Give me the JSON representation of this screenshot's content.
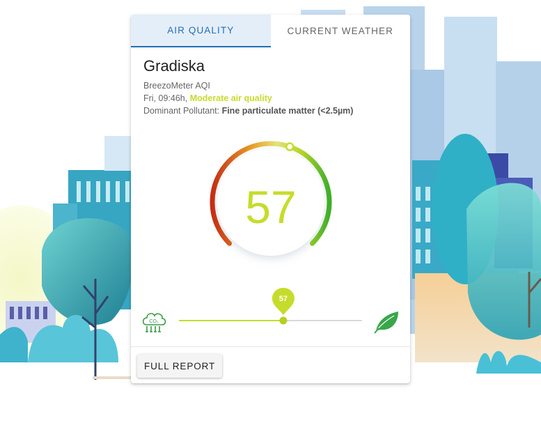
{
  "tabs": [
    {
      "label": "AIR QUALITY",
      "active": true
    },
    {
      "label": "CURRENT WEATHER",
      "active": false
    }
  ],
  "location": {
    "city": "Gradiska",
    "index_name": "BreezoMeter AQI",
    "datetime": "Fri, 09:46h,",
    "aqi_description": "Moderate air quality",
    "pollutant_label": "Dominant Pollutant:",
    "pollutant_value": "Fine particulate matter (<2.5µm)"
  },
  "gauge": {
    "value": "57",
    "value_color": "#c6dc2c",
    "level": 0.57
  },
  "slider": {
    "value_label": "57",
    "level": 0.57,
    "accent_color": "#c6dc2c",
    "left_icon": "co2-cloud-icon",
    "right_icon": "leaf-icon"
  },
  "actions": {
    "full_report_label": "FULL REPORT"
  }
}
